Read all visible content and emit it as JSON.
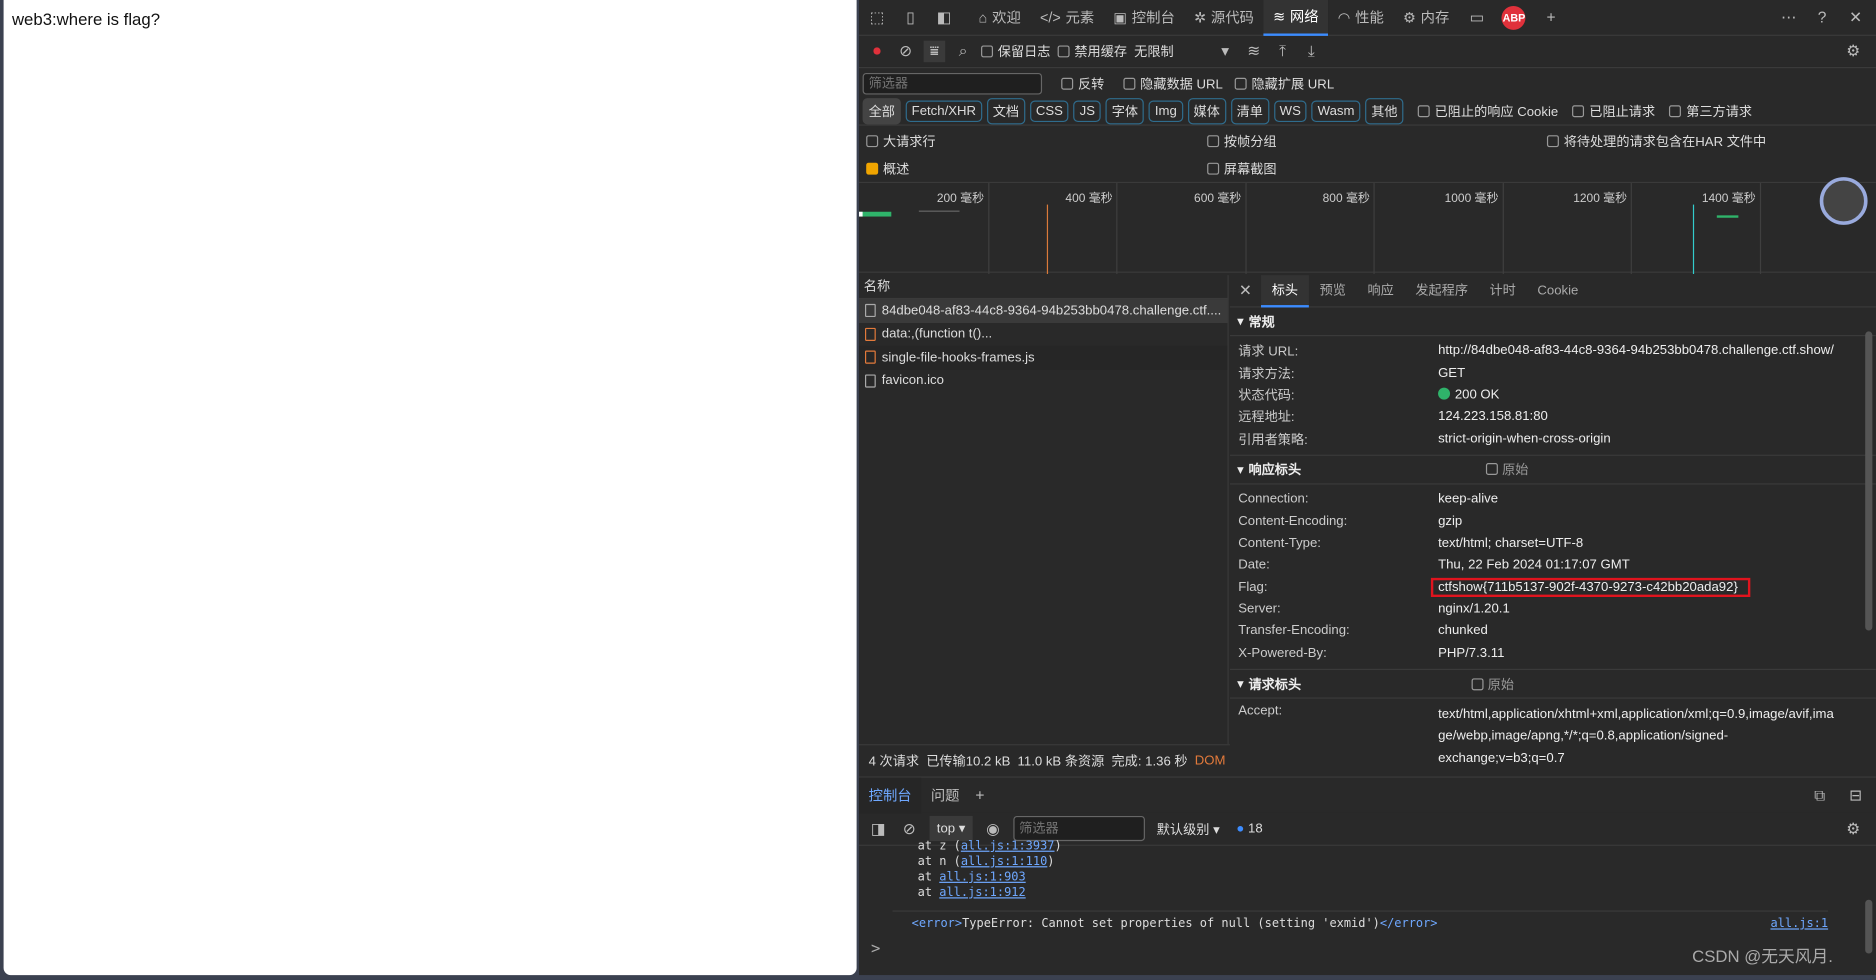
{
  "page": {
    "text": "web3:where is flag?"
  },
  "devtools": {
    "tabs": [
      {
        "label": "欢迎",
        "icon": "home-icon"
      },
      {
        "label": "元素",
        "icon": "code-icon"
      },
      {
        "label": "控制台",
        "icon": "console-icon"
      },
      {
        "label": "源代码",
        "icon": "bug-icon"
      },
      {
        "label": "网络",
        "icon": "wifi-icon",
        "active": true
      },
      {
        "label": "性能",
        "icon": "gauge-icon"
      },
      {
        "label": "内存",
        "icon": "chip-icon"
      }
    ],
    "abp": "ABP",
    "toolbar": {
      "preserve_log": "保留日志",
      "disable_cache": "禁用缓存",
      "throttle": "无限制"
    },
    "filter": {
      "placeholder": "筛选器",
      "invert": "反转",
      "hide_data_urls": "隐藏数据 URL",
      "hide_ext_urls": "隐藏扩展 URL"
    },
    "types": [
      "全部",
      "Fetch/XHR",
      "文档",
      "CSS",
      "JS",
      "字体",
      "Img",
      "媒体",
      "清单",
      "WS",
      "Wasm",
      "其他"
    ],
    "type_checks": [
      "已阻止的响应 Cookie",
      "已阻止请求",
      "第三方请求"
    ],
    "options": {
      "big_rows": "大请求行",
      "group_by_frame": "按帧分组",
      "include_har": "将待处理的请求包含在HAR 文件中",
      "overview": "概述",
      "screenshots": "屏幕截图"
    },
    "timeline_ticks": [
      "200 毫秒",
      "400 毫秒",
      "600 毫秒",
      "800 毫秒",
      "1000 毫秒",
      "1200 毫秒",
      "1400 毫秒"
    ],
    "list": {
      "header": "名称",
      "items": [
        "84dbe048-af83-44c8-9364-94b253bb0478.challenge.ctf....",
        "data:,(function t()...",
        "single-file-hooks-frames.js",
        "favicon.ico"
      ]
    },
    "detail_tabs": [
      "标头",
      "预览",
      "响应",
      "发起程序",
      "计时",
      "Cookie"
    ],
    "general": {
      "title": "常规",
      "rows": [
        [
          "请求 URL:",
          "http://84dbe048-af83-44c8-9364-94b253bb0478.challenge.ctf.show/"
        ],
        [
          "请求方法:",
          "GET"
        ],
        [
          "状态代码:",
          "200 OK"
        ],
        [
          "远程地址:",
          "124.223.158.81:80"
        ],
        [
          "引用者策略:",
          "strict-origin-when-cross-origin"
        ]
      ]
    },
    "response_headers": {
      "title": "响应标头",
      "raw": "原始",
      "rows": [
        [
          "Connection:",
          "keep-alive"
        ],
        [
          "Content-Encoding:",
          "gzip"
        ],
        [
          "Content-Type:",
          "text/html; charset=UTF-8"
        ],
        [
          "Date:",
          "Thu, 22 Feb 2024 01:17:07 GMT"
        ],
        [
          "Flag:",
          "ctfshow{711b5137-902f-4370-9273-c42bb20ada92}"
        ],
        [
          "Server:",
          "nginx/1.20.1"
        ],
        [
          "Transfer-Encoding:",
          "chunked"
        ],
        [
          "X-Powered-By:",
          "PHP/7.3.11"
        ]
      ]
    },
    "request_headers": {
      "title": "请求标头",
      "raw": "原始",
      "accept_key": "Accept:",
      "accept_lines": [
        "text/html,application/xhtml+xml,application/xml;q=0.9,image/avif,ima",
        "ge/webp,image/apng,*/*;q=0.8,application/signed-",
        "exchange;v=b3;q=0.7"
      ]
    },
    "status": {
      "requests": "4 次请求",
      "transferred": "已传输10.2 kB",
      "resources": "11.0 kB 条资源",
      "finish": "完成: 1.36 秒",
      "dom": "DOM"
    },
    "drawer": {
      "tabs": [
        "控制台",
        "问题"
      ]
    },
    "console_toolbar": {
      "context": "top",
      "filter_placeholder": "筛选器",
      "level": "默认级别",
      "count": "18"
    },
    "console": {
      "lines": [
        [
          "at z (",
          "all.js:1:3937",
          ")"
        ],
        [
          "at n (",
          "all.js:1:110",
          ")"
        ],
        [
          "at ",
          "all.js:1:903",
          ""
        ],
        [
          "at ",
          "all.js:1:912",
          ""
        ]
      ],
      "error_open": "<error>",
      "error_text": "TypeError: Cannot set properties of null (setting 'exmid')",
      "error_close": "</error>",
      "error_src": "all.js:1",
      "prompt": ">"
    }
  },
  "watermark": "CSDN @无天风月."
}
